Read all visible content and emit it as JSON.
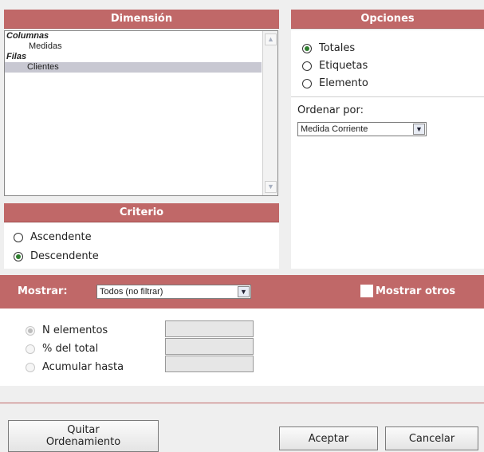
{
  "dimension": {
    "title": "Dimensión",
    "items": [
      {
        "label": "Columnas",
        "kind": "group"
      },
      {
        "label": "Medidas",
        "kind": "child"
      },
      {
        "label": "Filas",
        "kind": "group"
      },
      {
        "label": "Clientes",
        "kind": "child",
        "selected": true
      }
    ]
  },
  "options": {
    "title": "Opciones",
    "radios": [
      {
        "label": "Totales",
        "checked": true
      },
      {
        "label": "Etiquetas",
        "checked": false
      },
      {
        "label": "Elemento",
        "checked": false
      }
    ],
    "sort_label": "Ordenar por:",
    "sort_value": "Medida Corriente"
  },
  "criteria": {
    "title": "Criterio",
    "radios": [
      {
        "label": "Ascendente",
        "checked": false
      },
      {
        "label": "Descendente",
        "checked": true
      }
    ]
  },
  "show": {
    "label": "Mostrar:",
    "filter_value": "Todos (no filtrar)",
    "show_others_label": "Mostrar otros",
    "show_others_checked": false,
    "rows": [
      {
        "label": "N elementos",
        "checked": true
      },
      {
        "label": "% del total",
        "checked": false
      },
      {
        "label": "Acumular hasta",
        "checked": false
      }
    ]
  },
  "buttons": {
    "remove_sort_line1": "Quitar",
    "remove_sort_line2": "Ordenamiento",
    "accept": "Aceptar",
    "cancel": "Cancelar"
  },
  "colors": {
    "header_red": "#c06868",
    "radio_dot": "#2f7f2f"
  }
}
